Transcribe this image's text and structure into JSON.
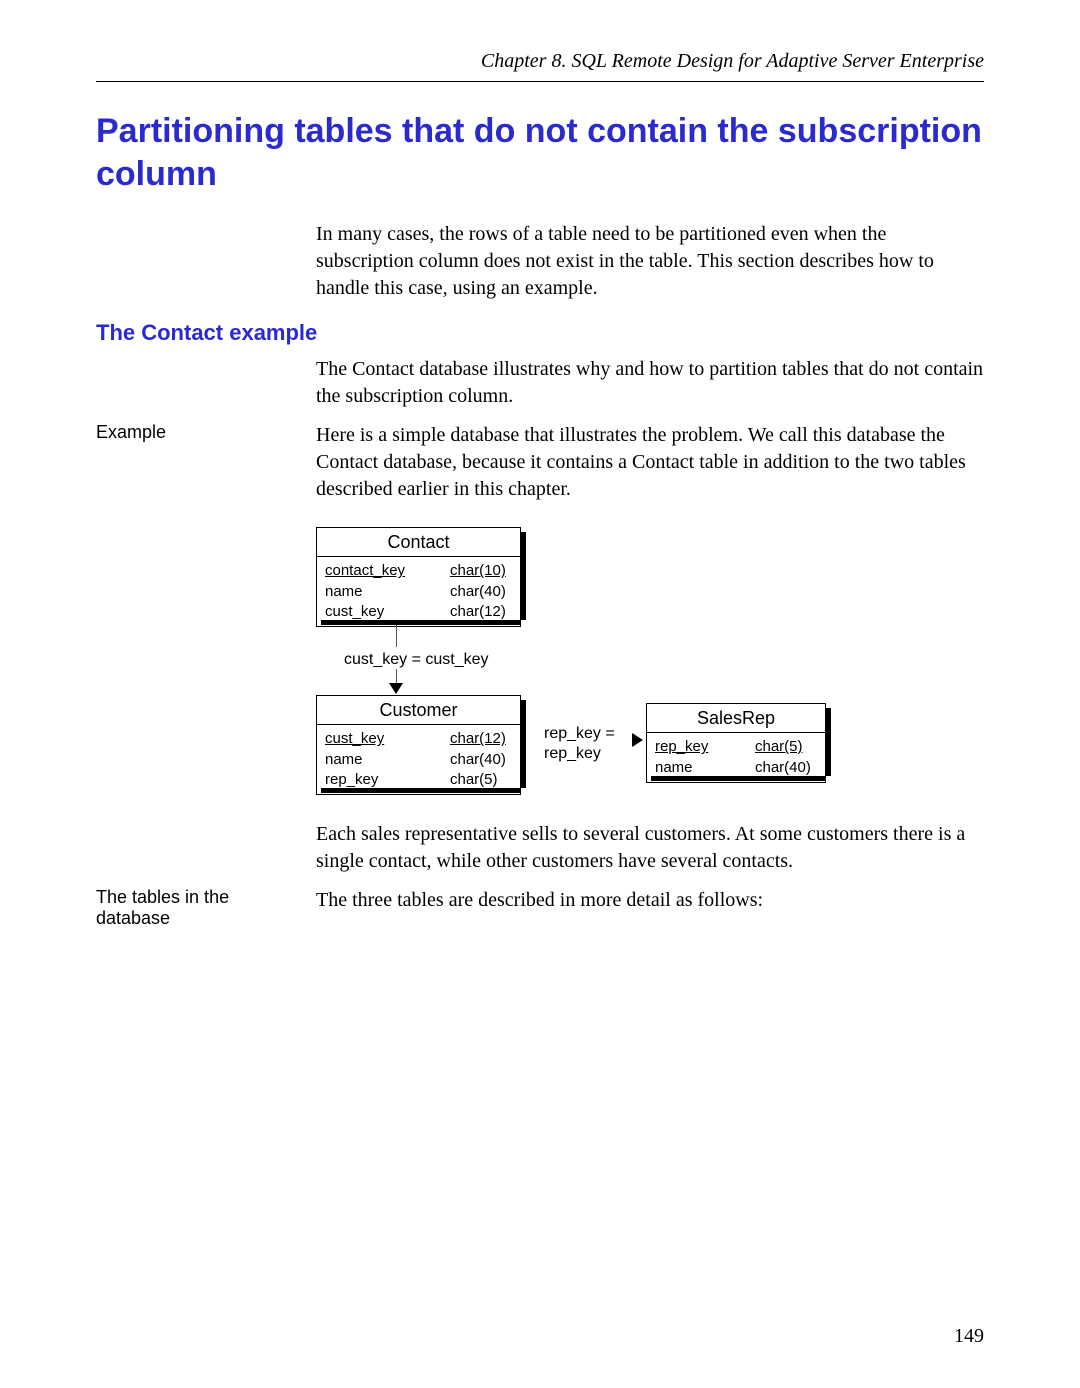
{
  "header": {
    "running": "Chapter 8.  SQL Remote Design for Adaptive Server Enterprise"
  },
  "title": "Partitioning tables that do not contain the subscription column",
  "intro": "In many cases, the rows of a table need to be partitioned even when the subscription column does not exist in the table. This section describes how to handle this case, using an example.",
  "section_heading": "The Contact example",
  "section_intro": "The Contact database illustrates why and how to partition tables that do not contain the subscription column.",
  "margin_labels": {
    "example": "Example",
    "tables": "The tables in the database"
  },
  "example_text": "Here is a simple database that illustrates the problem. We call this database the Contact database, because it contains a Contact table in addition to the two tables described earlier in this chapter.",
  "after_diagram": "Each sales representative sells to several customers. At some customers there is a single contact, while other customers have several contacts.",
  "tables_text": "The three tables are described in more detail as follows:",
  "diagram": {
    "contact": {
      "title": "Contact",
      "cols": [
        {
          "name": "contact_key",
          "type": "char(10)",
          "pk": true
        },
        {
          "name": "name",
          "type": "char(40)",
          "pk": false
        },
        {
          "name": "cust_key",
          "type": "char(12)",
          "pk": false
        }
      ]
    },
    "customer": {
      "title": "Customer",
      "cols": [
        {
          "name": "cust_key",
          "type": "char(12)",
          "pk": true
        },
        {
          "name": "name",
          "type": "char(40)",
          "pk": false
        },
        {
          "name": "rep_key",
          "type": "char(5)",
          "pk": false
        }
      ]
    },
    "salesrep": {
      "title": "SalesRep",
      "cols": [
        {
          "name": "rep_key",
          "type": "char(5)",
          "pk": true
        },
        {
          "name": "name",
          "type": "char(40)",
          "pk": false
        }
      ]
    },
    "rel1": "cust_key = cust_key",
    "rel2a": "rep_key =",
    "rel2b": "rep_key"
  },
  "page_number": "149"
}
